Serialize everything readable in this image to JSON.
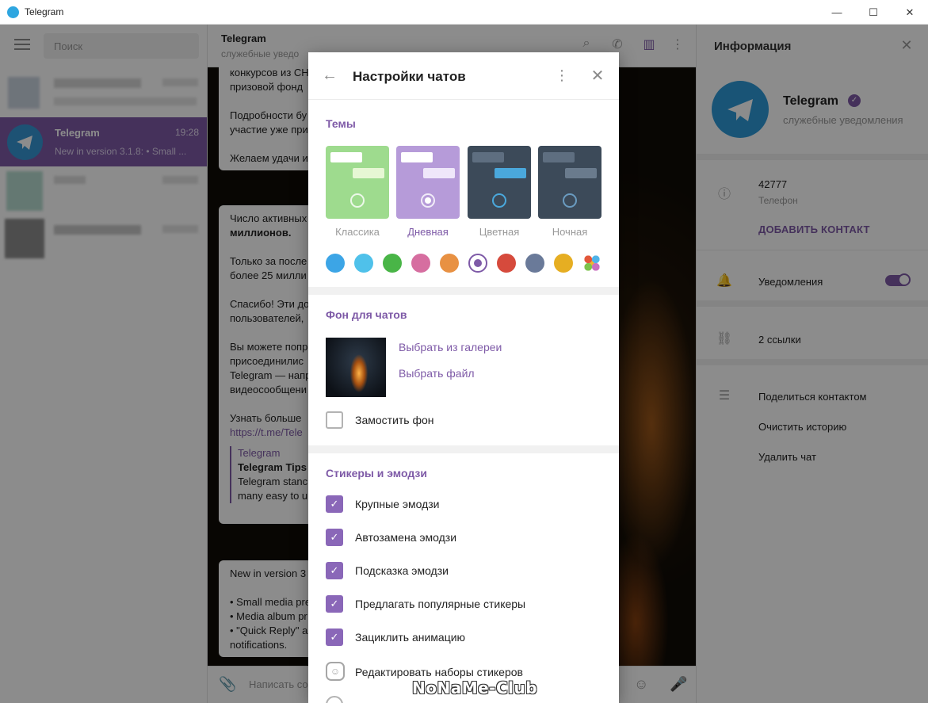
{
  "window": {
    "title": "Telegram",
    "minimize": "—",
    "maximize": "☐",
    "close": "✕"
  },
  "sidebar": {
    "search_placeholder": "Поиск",
    "active_chat": {
      "name": "Telegram",
      "time": "19:28",
      "snippet": "New in version 3.1.8: • Small ..."
    }
  },
  "chat": {
    "title": "Telegram",
    "subtitle": "служебные уведо",
    "composer_placeholder": "Написать со",
    "bubbles": {
      "b1": [
        "конкурсов из СН",
        "призовой фонд",
        "",
        "Подробности бу",
        "участие уже при",
        "",
        "Желаем удачи и"
      ],
      "b2_lines": [
        "Число активных",
        "миллионов.",
        "Только за после",
        "более 25 милли",
        "Спасибо! Эти до",
        "пользователей,",
        "Вы можете попр",
        "присоединилис",
        "Telegram — напр",
        "видеосообщени",
        "Узнать больше",
        "https://t.me/Tele",
        "Telegram",
        "Telegram Tips",
        "Telegram stanc",
        "many easy to u"
      ],
      "b3_lines": [
        "New in version 3",
        "• Small media pre",
        "• Media album pr",
        "• \"Quick Reply\" a",
        "notifications."
      ]
    }
  },
  "info": {
    "title": "Информация",
    "name": "Telegram",
    "status": "служебные уведомления",
    "phone": "42777",
    "phone_label": "Телефон",
    "add_contact": "ДОБАВИТЬ КОНТАКТ",
    "notifications": "Уведомления",
    "notifications_on": true,
    "links": "2 ссылки",
    "share_contact": "Поделиться контактом",
    "clear_history": "Очистить историю",
    "delete_chat": "Удалить чат"
  },
  "modal": {
    "title": "Настройки чатов",
    "themes": {
      "section": "Темы",
      "items": [
        {
          "label": "Классика",
          "color": "#9edb8e",
          "selected": false
        },
        {
          "label": "Дневная",
          "color": "#b69bd9",
          "selected": true
        },
        {
          "label": "Цветная",
          "color": "#3c4a59",
          "selected": false
        },
        {
          "label": "Ночная",
          "color": "#3c4a59",
          "selected": false
        }
      ],
      "accent_colors": [
        "#3ca5e6",
        "#4fc1ea",
        "#49b547",
        "#d66ea0",
        "#e89143",
        "#8a67b8",
        "#d64a3c",
        "#6a7a99",
        "#e6ae22",
        "multi"
      ],
      "selected_accent": 5
    },
    "background": {
      "section": "Фон для чатов",
      "choose_gallery": "Выбрать из галереи",
      "choose_file": "Выбрать файл",
      "tile": "Замостить фон",
      "tile_checked": false
    },
    "stickers": {
      "section": "Стикеры и эмодзи",
      "options": [
        {
          "label": "Крупные эмодзи",
          "checked": true
        },
        {
          "label": "Автозамена эмодзи",
          "checked": true
        },
        {
          "label": "Подсказка эмодзи",
          "checked": true
        },
        {
          "label": "Предлагать популярные стикеры",
          "checked": true
        },
        {
          "label": "Зациклить анимацию",
          "checked": true
        }
      ],
      "edit_sets": "Редактировать наборы стикеров"
    }
  },
  "watermark": "NoNaMe-Club",
  "colors": {
    "accent": "#7e5aa7",
    "overlay": "rgba(0,0,0,0.45)"
  }
}
